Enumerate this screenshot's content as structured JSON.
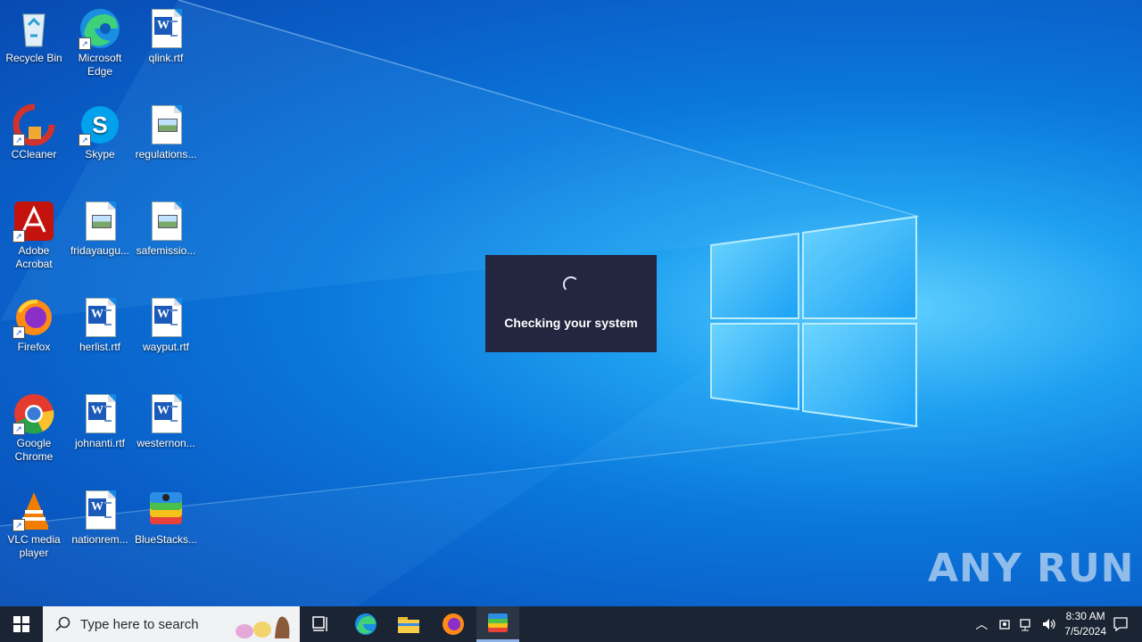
{
  "desktop": {
    "icons": [
      {
        "label": "Recycle Bin",
        "icon": "recycle-bin-icon"
      },
      {
        "label": "Microsoft Edge",
        "icon": "edge-icon"
      },
      {
        "label": "qlink.rtf",
        "icon": "word-document-icon"
      },
      {
        "label": "CCleaner",
        "icon": "ccleaner-icon"
      },
      {
        "label": "Skype",
        "icon": "skype-icon"
      },
      {
        "label": "regulations...",
        "icon": "image-file-icon"
      },
      {
        "label": "Adobe Acrobat",
        "icon": "acrobat-icon"
      },
      {
        "label": "fridayaugu...",
        "icon": "image-file-icon"
      },
      {
        "label": "safemissio...",
        "icon": "image-file-icon"
      },
      {
        "label": "Firefox",
        "icon": "firefox-icon"
      },
      {
        "label": "herlist.rtf",
        "icon": "word-document-icon"
      },
      {
        "label": "wayput.rtf",
        "icon": "word-document-icon"
      },
      {
        "label": "Google Chrome",
        "icon": "chrome-icon"
      },
      {
        "label": "johnanti.rtf",
        "icon": "word-document-icon"
      },
      {
        "label": "westernon...",
        "icon": "word-document-icon"
      },
      {
        "label": "VLC media player",
        "icon": "vlc-icon"
      },
      {
        "label": "nationrem...",
        "icon": "word-document-icon"
      },
      {
        "label": "BlueStacks...",
        "icon": "bluestacks-icon"
      }
    ]
  },
  "dialog": {
    "message": "Checking your system"
  },
  "watermark": "ANY RUN",
  "taskbar": {
    "search_placeholder": "Type here to search",
    "apps": [
      "task-view-icon",
      "edge-icon",
      "file-explorer-icon",
      "firefox-icon",
      "bluestacks-icon"
    ],
    "clock_time": "8:30 AM",
    "clock_date": "7/5/2024"
  },
  "colors": {
    "taskbar": "#1a2433",
    "dialog_bg": "#24253e",
    "desktop_blue": "#0a78dc"
  }
}
